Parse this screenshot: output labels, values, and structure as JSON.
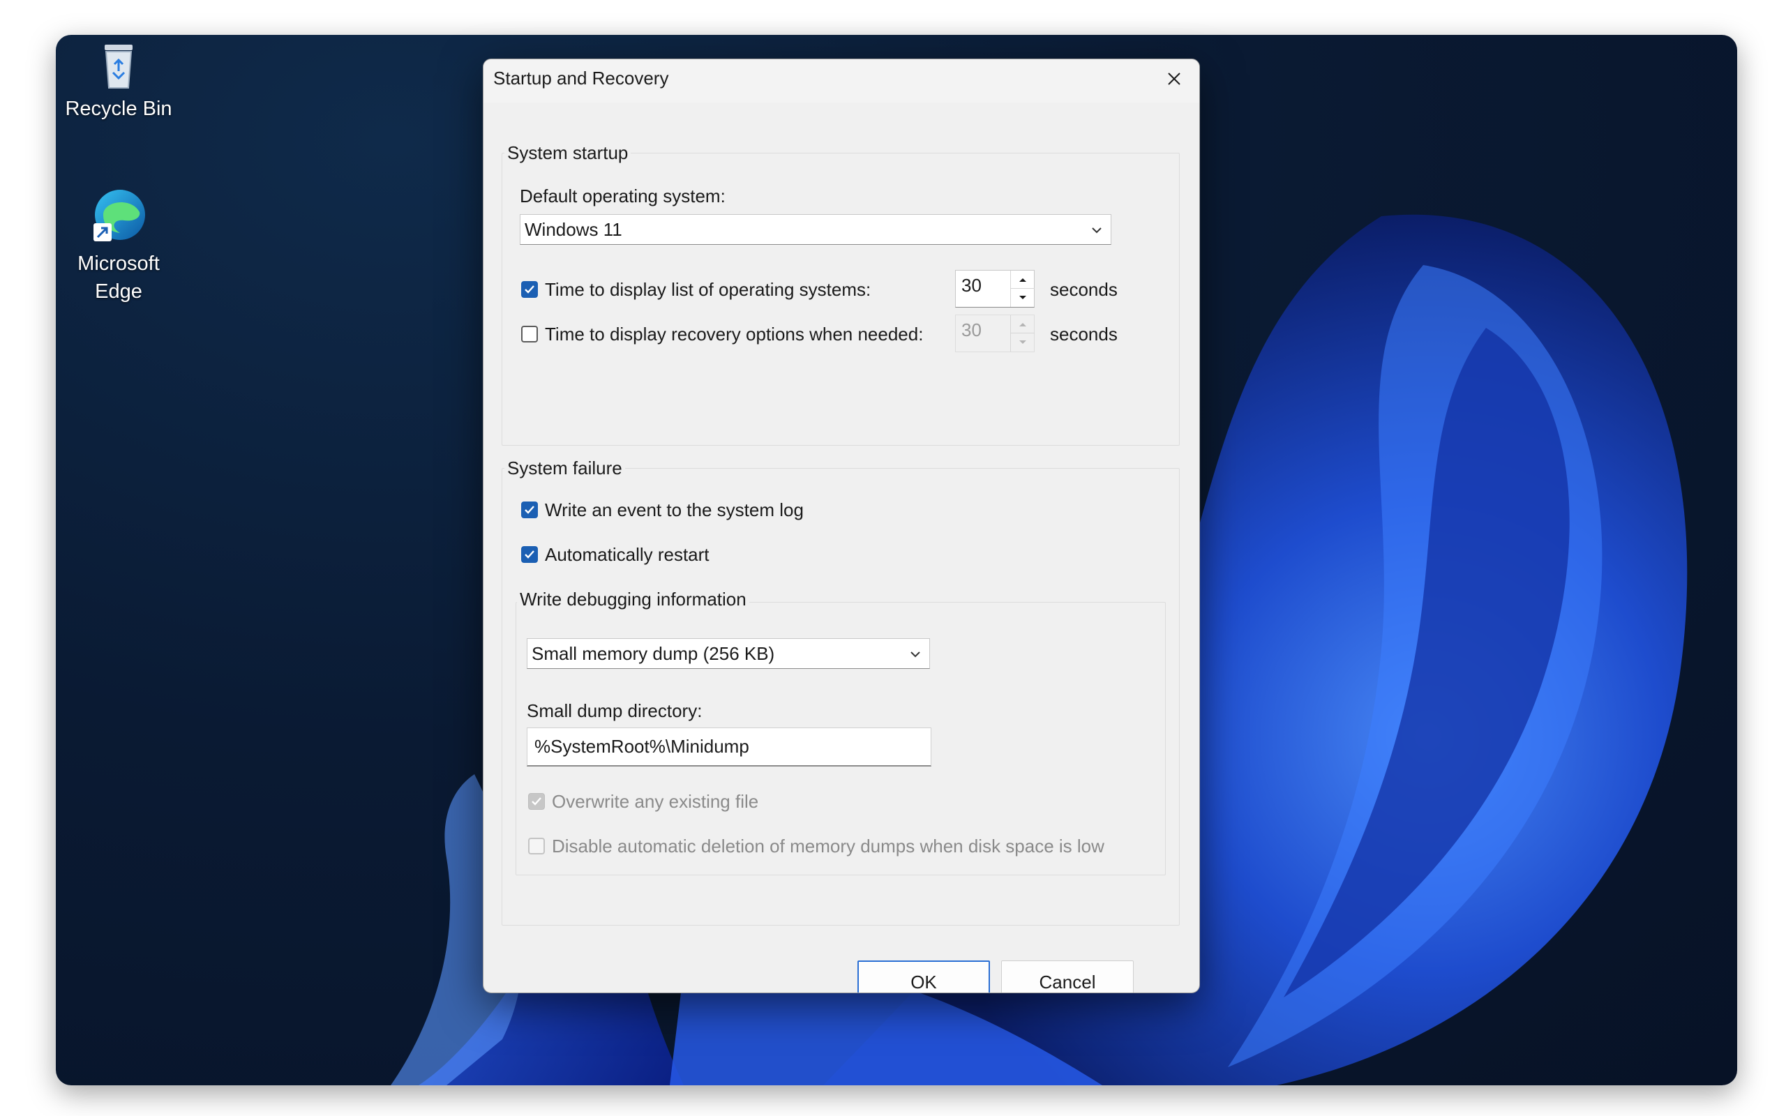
{
  "desktop": {
    "icons": [
      {
        "label": "Recycle Bin",
        "icon": "recycle-bin-icon"
      },
      {
        "label": "Microsoft Edge",
        "icon": "edge-icon"
      }
    ]
  },
  "dialog": {
    "title": "Startup and Recovery",
    "system_startup": {
      "group_title": "System startup",
      "default_os_label": "Default operating system:",
      "default_os_value": "Windows 11",
      "time_list_label": "Time to display list of operating systems:",
      "time_list_checked": true,
      "time_list_value": "30",
      "time_list_unit": "seconds",
      "time_recovery_label": "Time to display recovery options when needed:",
      "time_recovery_checked": false,
      "time_recovery_value": "30",
      "time_recovery_unit": "seconds"
    },
    "system_failure": {
      "group_title": "System failure",
      "write_event_label": "Write an event to the system log",
      "write_event_checked": true,
      "auto_restart_label": "Automatically restart",
      "auto_restart_checked": true,
      "debug_group_title": "Write debugging information",
      "dump_type_value": "Small memory dump (256 KB)",
      "dump_dir_label": "Small dump directory:",
      "dump_dir_value": "%SystemRoot%\\Minidump",
      "overwrite_label": "Overwrite any existing file",
      "overwrite_checked": true,
      "disable_deletion_label": "Disable automatic deletion of memory dumps when disk space is low",
      "disable_deletion_checked": false
    },
    "buttons": {
      "ok": "OK",
      "cancel": "Cancel"
    }
  },
  "colors": {
    "accent": "#1b5fb3",
    "primary_border": "#2a6fd4",
    "wallpaper": "#0a1a33"
  }
}
